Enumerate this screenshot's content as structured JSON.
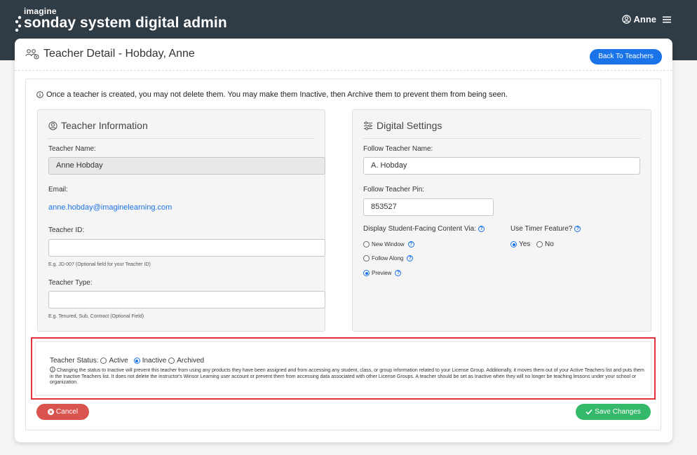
{
  "brand": {
    "small": "imagine",
    "main": "sonday system digital admin"
  },
  "user": {
    "name": "Anne",
    "icons": [
      "user-circle-icon",
      "hamburger-menu-icon"
    ]
  },
  "page": {
    "title": "Teacher Detail - Hobday, Anne",
    "back_label": "Back To Teachers"
  },
  "notice": "Once a teacher is created, you may not delete them. You may make them Inactive, then Archive them to prevent them from being seen.",
  "teacher_info": {
    "title": "Teacher Information",
    "name_label": "Teacher Name:",
    "name_value": "Anne Hobday",
    "email_label": "Email:",
    "email_value": "anne.hobday@imaginelearning.com",
    "id_label": "Teacher ID:",
    "id_value": "",
    "id_help": "E.g. JD-007 (Optional field for your Teacher ID)",
    "type_label": "Teacher Type:",
    "type_value": "",
    "type_help": "E.g. Tenured, Sub, Contract (Optional Field)"
  },
  "digital": {
    "title": "Digital Settings",
    "follow_name_label": "Follow Teacher Name:",
    "follow_name_value": "A. Hobday",
    "pin_label": "Follow Teacher Pin:",
    "pin_value": "853527",
    "display_label": "Display Student-Facing Content Via:",
    "display_options": [
      "New Window",
      "Follow Along",
      "Preview"
    ],
    "display_selected": "Preview",
    "timer_label": "Use Timer Feature?",
    "timer_options": [
      "Yes",
      "No"
    ],
    "timer_selected": "Yes"
  },
  "status": {
    "label": "Teacher Status:",
    "options": [
      "Active",
      "Inactive",
      "Archived"
    ],
    "selected": "Inactive",
    "note": "Changing the status to Inactive will prevent this teacher from using any products they have been assigned and from accessing any student, class, or group information related to your License Group. Additionally, it moves them out of your Active Teachers list and puts them in the Inactive Teachers list. It does not delete the instructor's Winsor Learning user account or prevent them from accessing data associated with other License Groups. A teacher should be set as Inactive when they will no longer be teaching lessons under your school or organization."
  },
  "actions": {
    "cancel": "Cancel",
    "save": "Save Changes"
  },
  "colors": {
    "accent": "#1a73e8",
    "danger": "#d9534f",
    "success": "#34b86a",
    "header": "#2f3b45",
    "highlight": "#e0333a"
  }
}
